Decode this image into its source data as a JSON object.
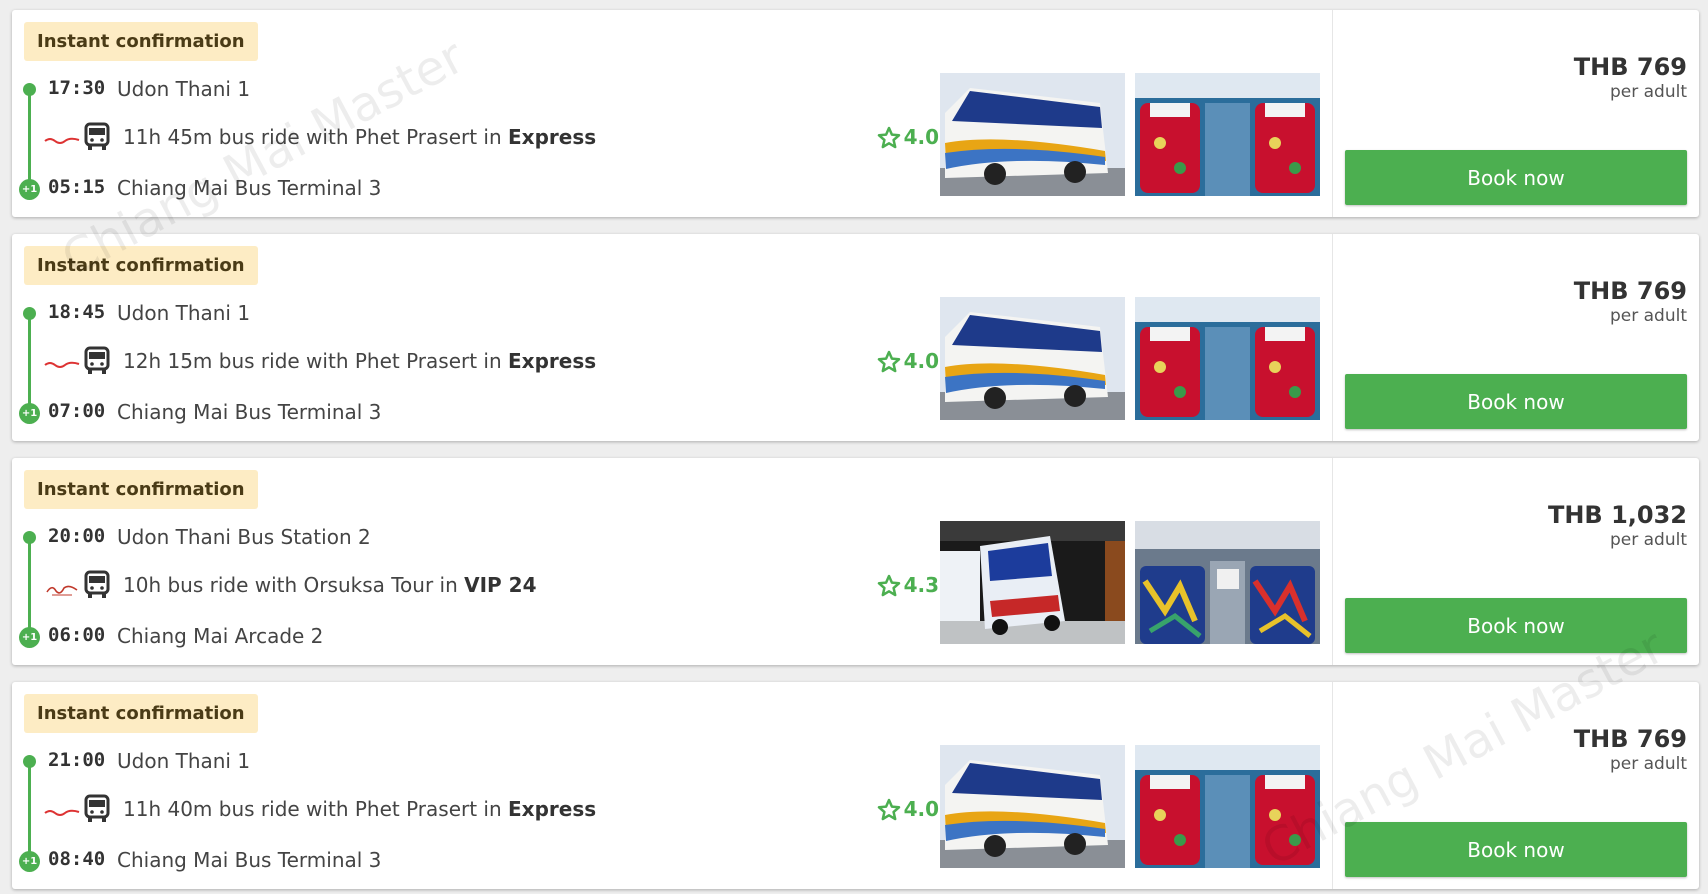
{
  "watermark": "Chiang Mai Master",
  "colors": {
    "accent": "#4caf50",
    "badge_bg": "#fdecc4"
  },
  "trips": [
    {
      "badge": "Instant confirmation",
      "depart_time": "17:30",
      "depart_place": "Udon Thani 1",
      "day_offset": "+1",
      "ride_text": "11h 45m bus ride with Phet Prasert in ",
      "class": "Express",
      "operator_logo": "Phet Prasert logo",
      "rating": "4.0",
      "arrive_time": "05:15",
      "arrive_place": "Chiang Mai Bus Terminal 3",
      "price": "THB 769",
      "per": "per adult",
      "book": "Book now",
      "photos": [
        "yellow-double-decker-bus",
        "red-floral-seats"
      ]
    },
    {
      "badge": "Instant confirmation",
      "depart_time": "18:45",
      "depart_place": "Udon Thani 1",
      "day_offset": "+1",
      "ride_text": "12h 15m bus ride with Phet Prasert in ",
      "class": "Express",
      "operator_logo": "Phet Prasert logo",
      "rating": "4.0",
      "arrive_time": "07:00",
      "arrive_place": "Chiang Mai Bus Terminal 3",
      "price": "THB 769",
      "per": "per adult",
      "book": "Book now",
      "photos": [
        "yellow-double-decker-bus",
        "red-floral-seats"
      ]
    },
    {
      "badge": "Instant confirmation",
      "depart_time": "20:00",
      "depart_place": "Udon Thani Bus Station 2",
      "day_offset": "+1",
      "ride_text": "10h bus ride with Orsuksa Tour in ",
      "class": "VIP 24",
      "operator_logo": "Orsuksa Tour logo",
      "rating": "4.3",
      "arrive_time": "06:00",
      "arrive_place": "Chiang Mai Arcade 2",
      "price": "THB 1,032",
      "per": "per adult",
      "book": "Book now",
      "photos": [
        "white-blue-bus-at-night",
        "colorful-seats"
      ]
    },
    {
      "badge": "Instant confirmation",
      "depart_time": "21:00",
      "depart_place": "Udon Thani 1",
      "day_offset": "+1",
      "ride_text": "11h 40m bus ride with Phet Prasert in ",
      "class": "Express",
      "operator_logo": "Phet Prasert logo",
      "rating": "4.0",
      "arrive_time": "08:40",
      "arrive_place": "Chiang Mai Bus Terminal 3",
      "price": "THB 769",
      "per": "per adult",
      "book": "Book now",
      "photos": [
        "yellow-double-decker-bus",
        "red-floral-seats"
      ]
    }
  ]
}
